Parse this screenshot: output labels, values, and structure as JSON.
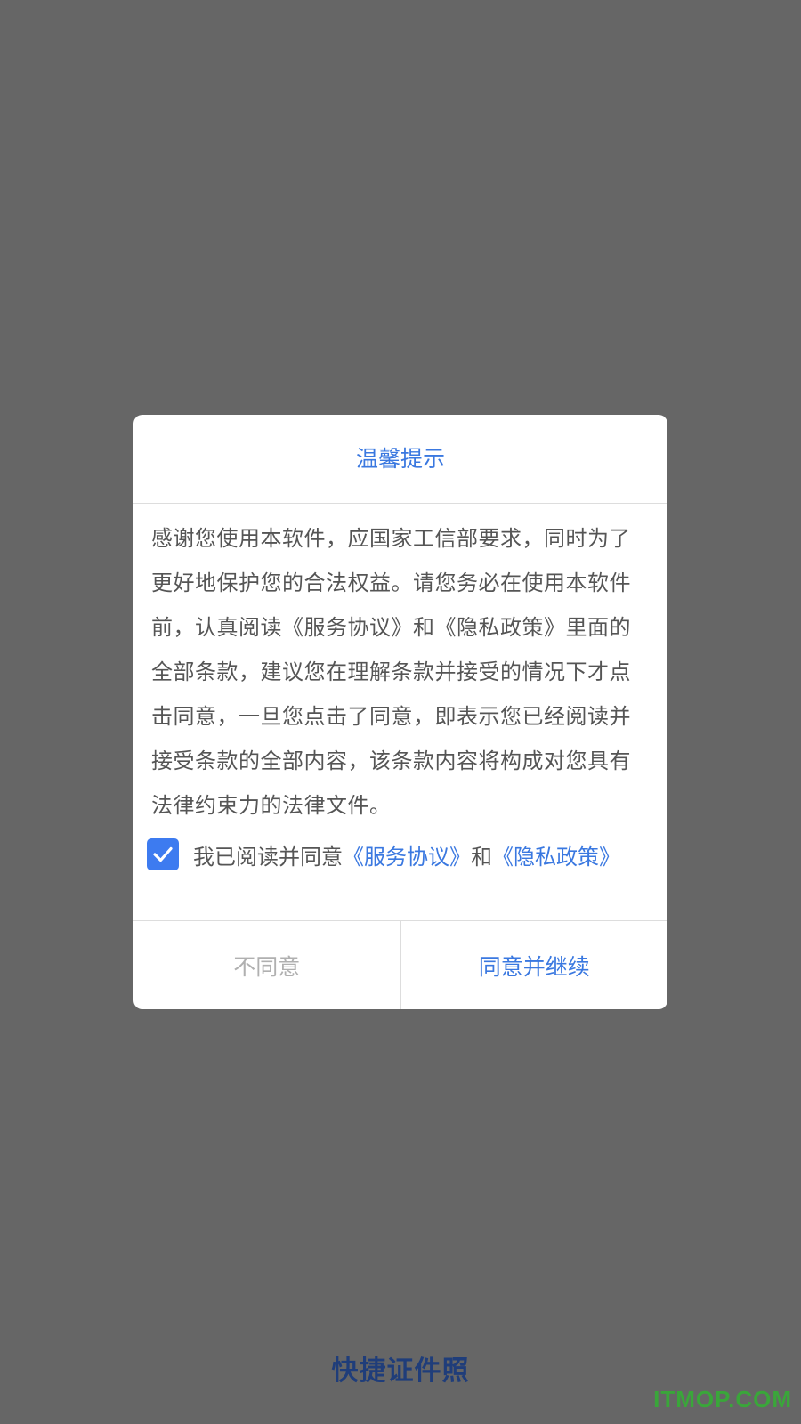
{
  "dialog": {
    "title": "温馨提示",
    "body": "感谢您使用本软件，应国家工信部要求，同时为了更好地保护您的合法权益。请您务必在使用本软件前，认真阅读《服务协议》和《隐私政策》里面的全部条款，建议您在理解条款并接受的情况下才点击同意，一旦您点击了同意，即表示您已经阅读并接受条款的全部内容，该条款内容将构成对您具有法律约束力的法律文件。",
    "agree_checked": true,
    "agree_prefix": "我已阅读并同意",
    "service_link": "《服务协议》",
    "agree_and": "和",
    "privacy_link": "《隐私政策》",
    "decline_label": "不同意",
    "accept_label": "同意并继续"
  },
  "app": {
    "name": "快捷证件照"
  },
  "watermark": "ITMOP.COM",
  "colors": {
    "overlay": "#666666",
    "accent": "#3a78e0",
    "checkbox": "#3d7bf0",
    "app_name": "#1f3d7a",
    "watermark": "#3aa63a"
  },
  "icons": {
    "checkbox": "checkmark-icon"
  }
}
